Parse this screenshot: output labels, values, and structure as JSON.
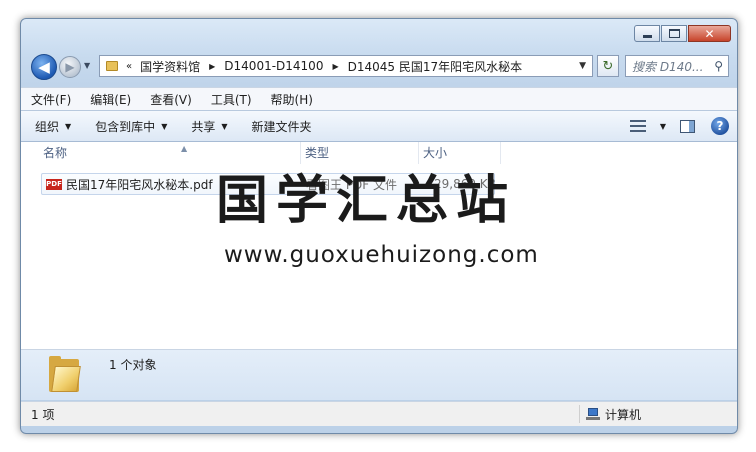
{
  "window": {
    "caption_buttons": {
      "minimize": "minimize",
      "maximize": "maximize",
      "close": "close"
    }
  },
  "nav": {
    "back_glyph": "◀",
    "forward_glyph": "▶",
    "recent_glyph": "▼",
    "breadcrumb_chevron": "«",
    "breadcrumb": [
      "国学资料馆",
      "D14001-D14100",
      "D14045 民国17年阳宅风水秘本"
    ],
    "separator": "▶",
    "dropdown_glyph": "▼",
    "refresh_glyph": "↻",
    "search_placeholder": "搜索 D140...",
    "search_icon_glyph": "⚲"
  },
  "menubar": {
    "items": [
      "文件(F)",
      "编辑(E)",
      "查看(V)",
      "工具(T)",
      "帮助(H)"
    ]
  },
  "toolbar": {
    "organize": "组织",
    "include_in_library": "包含到库中",
    "share": "共享",
    "new_folder": "新建文件夹",
    "caret": "▼",
    "help_glyph": "?"
  },
  "columns": {
    "name": "名称",
    "type": "类型",
    "size": "大小",
    "sort_glyph": "▲"
  },
  "files": [
    {
      "icon": "pdf-icon",
      "icon_text": "PDF",
      "name": "民国17年阳宅风水秘本.pdf",
      "type": "看图王 PDF 文件",
      "size": "29,869 KB"
    }
  ],
  "watermark": {
    "title": "国学汇总站",
    "url": "www.guoxuehuizong.com"
  },
  "details": {
    "object_count": "1 个对象"
  },
  "statusbar": {
    "items_count": "1 项",
    "location": "计算机"
  }
}
